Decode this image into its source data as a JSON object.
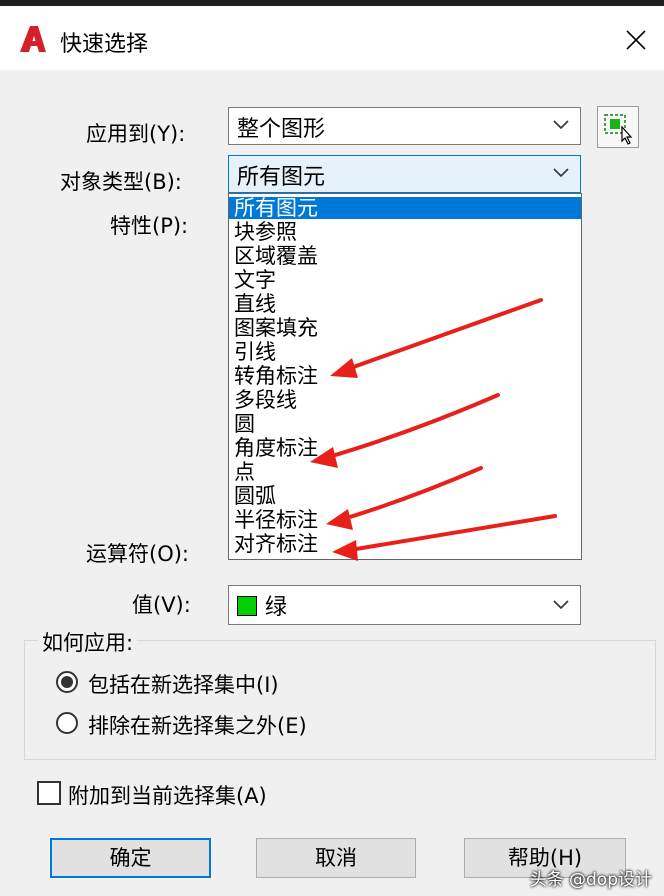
{
  "window": {
    "title": "快速选择"
  },
  "form": {
    "apply_to": {
      "label": "应用到(Y):",
      "value": "整个图形"
    },
    "object_type": {
      "label": "对象类型(B):",
      "value": "所有图元"
    },
    "properties": {
      "label": "特性(P):"
    },
    "operator": {
      "label": "运算符(O):"
    },
    "value": {
      "label": "值(V):",
      "value": "绿",
      "swatch_color": "#00d000"
    }
  },
  "object_type_options": [
    "所有图元",
    "块参照",
    "区域覆盖",
    "文字",
    "直线",
    "图案填充",
    "引线",
    "转角标注",
    "多段线",
    "圆",
    "角度标注",
    "点",
    "圆弧",
    "半径标注",
    "对齐标注"
  ],
  "selected_option": "所有图元",
  "how_to_apply": {
    "title": "如何应用:",
    "include": "包括在新选择集中(I)",
    "exclude": "排除在新选择集之外(E)",
    "selected": "include"
  },
  "append": {
    "label": "附加到当前选择集(A)",
    "checked": false
  },
  "buttons": {
    "ok": "确定",
    "cancel": "取消",
    "help": "帮助(H)"
  },
  "watermark": "头条 @dop设计",
  "colors": {
    "highlight": "#0078d7",
    "annotation_arrow": "#e8201a",
    "app_icon": "#d4202a"
  }
}
